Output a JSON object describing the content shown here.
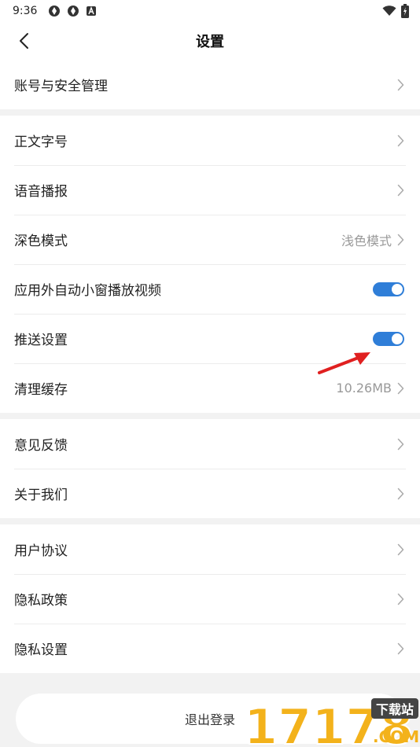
{
  "status_bar": {
    "time": "9:36"
  },
  "nav": {
    "title": "设置"
  },
  "groups": [
    [
      {
        "label": "账号与安全管理"
      }
    ],
    [
      {
        "label": "正文字号"
      },
      {
        "label": "语音播报"
      },
      {
        "label": "深色模式",
        "value": "浅色模式"
      },
      {
        "label": "应用外自动小窗播放视频",
        "toggle": true
      },
      {
        "label": "推送设置",
        "toggle": true
      },
      {
        "label": "清理缓存",
        "value": "10.26MB"
      }
    ],
    [
      {
        "label": "意见反馈"
      },
      {
        "label": "关于我们"
      }
    ],
    [
      {
        "label": "用户协议"
      },
      {
        "label": "隐私政策"
      },
      {
        "label": "隐私设置"
      }
    ]
  ],
  "logout": {
    "label": "退出登录"
  },
  "watermark": {
    "text": "17178",
    "badge": "下载站",
    "suffix": ".COM"
  },
  "colors": {
    "toggle_on": "#2f7ed8",
    "annotation": "#e02020",
    "watermark": "#f3b21b"
  }
}
